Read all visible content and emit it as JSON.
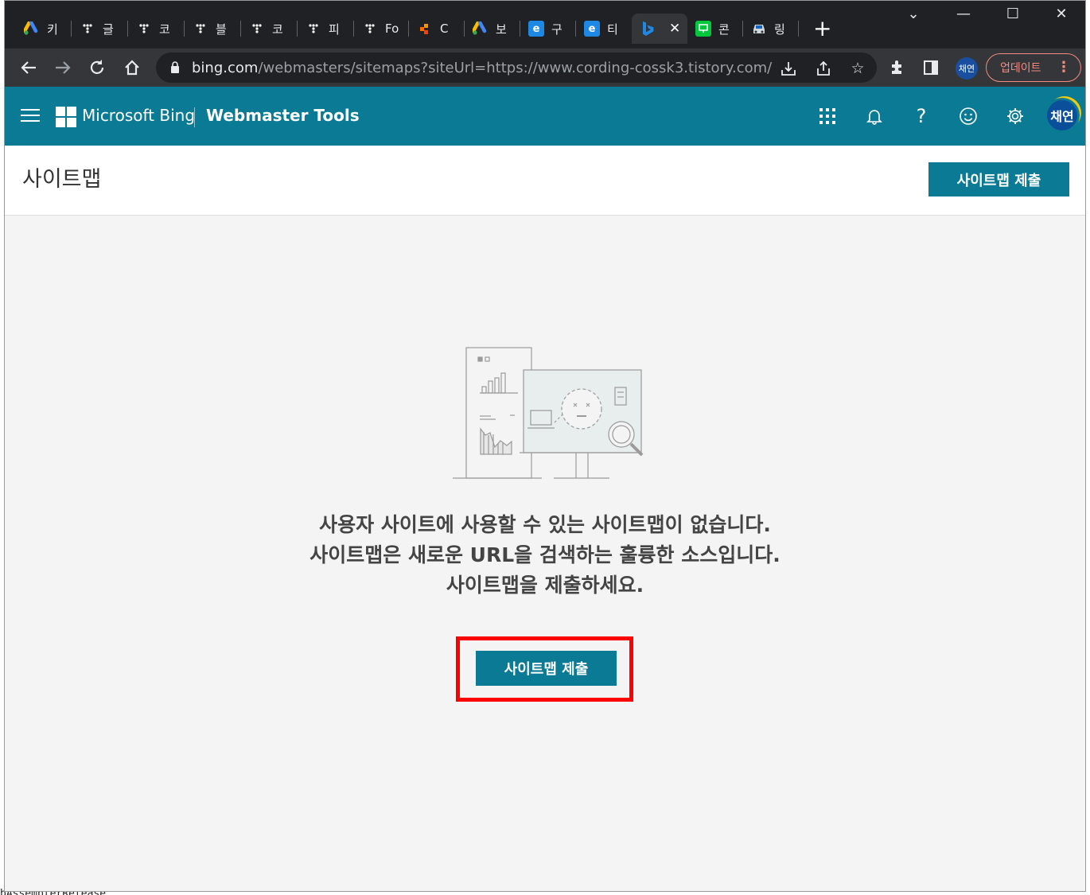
{
  "browser": {
    "tabs": [
      {
        "label": "키",
        "icon": "google-ads-icon",
        "color": "#fbbc04"
      },
      {
        "label": "글",
        "icon": "tistory-icon",
        "color": "#ffffff"
      },
      {
        "label": "코",
        "icon": "tistory-icon",
        "color": "#ffffff"
      },
      {
        "label": "블",
        "icon": "tistory-icon",
        "color": "#ffffff"
      },
      {
        "label": "코",
        "icon": "tistory-icon",
        "color": "#ffffff"
      },
      {
        "label": "피",
        "icon": "tistory-icon",
        "color": "#ffffff"
      },
      {
        "label": "Fo",
        "icon": "tistory-icon",
        "color": "#ffffff"
      },
      {
        "label": "C",
        "icon": "colorful-dots-icon",
        "color": "#ff6d00"
      },
      {
        "label": "보",
        "icon": "google-ads-icon",
        "color": "#fbbc04"
      },
      {
        "label": "구",
        "icon": "edge-blue-icon",
        "color": "#1e88e5"
      },
      {
        "label": "티",
        "icon": "edge-blue-icon",
        "color": "#1e88e5"
      },
      {
        "label": "",
        "icon": "bing-icon",
        "color": "#1e88e5",
        "active": true,
        "close": "✕"
      },
      {
        "label": "콘",
        "icon": "green-screen-icon",
        "color": "#00c73c"
      },
      {
        "label": "링",
        "icon": "car-icon",
        "color": "#cfd8dc"
      }
    ],
    "new_tab": "+",
    "window_controls": {
      "tablist": "⌄",
      "minimize": "—",
      "maximize": "☐",
      "close": "✕"
    },
    "url_host": "bing.com",
    "url_path": "/webmasters/sitemaps?siteUrl=https://www.cording-cossk3.tistory.com/",
    "profile_initials": "채연",
    "update_label": "업데이트",
    "menu_dots": "⋮"
  },
  "header": {
    "brand": "Microsoft Bing",
    "product": "Webmaster Tools",
    "avatar_initials": "채연"
  },
  "page": {
    "title": "사이트맵",
    "submit_top_label": "사이트맵 제출",
    "empty_lines": [
      "사용자 사이트에 사용할 수 있는 사이트맵이 없습니다.",
      "사이트맵은 새로운 URL을 검색하는 훌륭한 소스입니다.",
      "사이트맵을 제출하세요."
    ],
    "submit_center_label": "사이트맵 제출",
    "highlight_color": "#ff0000"
  },
  "background_text": "bAssemblerRelease"
}
